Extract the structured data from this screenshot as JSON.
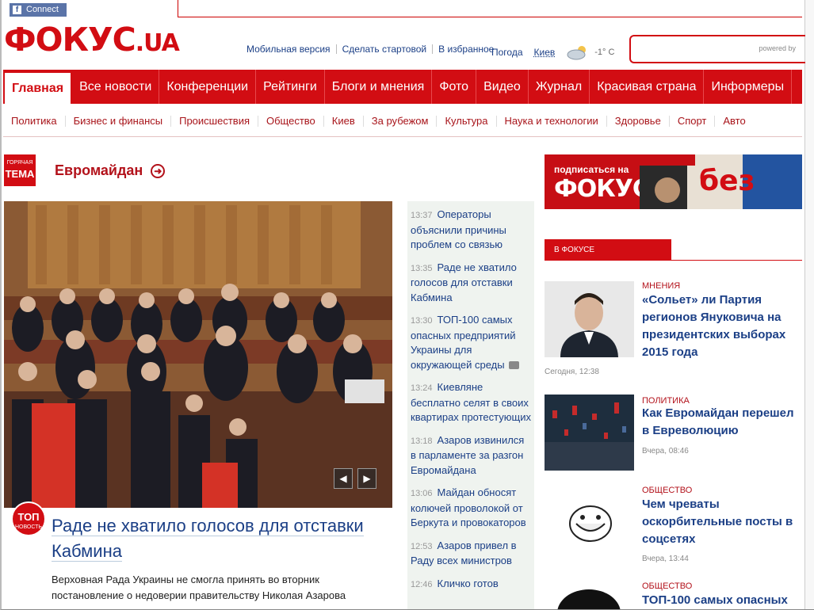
{
  "facebook": {
    "label": "Connect"
  },
  "logo": {
    "main": "ФОКУС",
    "suffix": ".UA"
  },
  "toplinks": [
    "Мобильная версия",
    "Сделать стартовой",
    "В избранное"
  ],
  "weather": {
    "label": "Погода",
    "city": "Киев",
    "temp": "-1° C",
    "icon": "cloud-sun-icon"
  },
  "search": {
    "powered": "powered by"
  },
  "mainnav": [
    "Главная",
    "Все новости",
    "Конференции",
    "Рейтинги",
    "Блоги и мнения",
    "Фото",
    "Видео",
    "Журнал",
    "Красивая страна",
    "Информеры"
  ],
  "subnav": [
    "Политика",
    "Бизнес и финансы",
    "Происшествия",
    "Общество",
    "Киев",
    "За рубежом",
    "Культура",
    "Наука и технологии",
    "Здоровье",
    "Спорт",
    "Авто"
  ],
  "hot": {
    "tag_small": "ГОРЯЧАЯ",
    "tag_big": "ТЕМА",
    "title": "Евромайдан"
  },
  "lead": {
    "badge_big": "ТОП",
    "badge_small": "НОВОСТЬ",
    "title": "Раде не хватило голосов для отставки Кабмина",
    "text": "Верховная Рада Украины не смогла принять во вторник постановление о недоверии правительству Николая Азарова"
  },
  "feed": [
    {
      "time": "13:37",
      "title": "Операторы объяснили причины проблем со связью"
    },
    {
      "time": "13:35",
      "title": "Раде не хватило голосов для отставки Кабмина"
    },
    {
      "time": "13:30",
      "title": "ТОП-100 самых опасных предприятий Украины для окружающей среды",
      "camera": true
    },
    {
      "time": "13:24",
      "title": "Киевляне бесплатно селят в своих квартирах протестующих"
    },
    {
      "time": "13:18",
      "title": "Азаров извинился в парламенте за разгон Евромайдана"
    },
    {
      "time": "13:06",
      "title": "Майдан обносят колючей проволокой от Беркута и провокаторов"
    },
    {
      "time": "12:53",
      "title": "Азаров привел в Раду всех министров"
    },
    {
      "time": "12:46",
      "title": "Кличко готов"
    }
  ],
  "banner": {
    "sub": "подписаться на",
    "big": "ФОКУС"
  },
  "infocus": {
    "label": "В ФОКУСЕ"
  },
  "cards": [
    {
      "cat": "МНЕНИЯ",
      "title": "«Сольет» ли Партия регионов Януковича на президентских выборах 2015 года",
      "date": "Сегодня, 12:38"
    },
    {
      "cat": "ПОЛИТИКА",
      "title": "Как Евромайдан перешел в Евреволюцию",
      "date": "Вчера, 08:46"
    },
    {
      "cat": "ОБЩЕСТВО",
      "title": "Чем чреваты оскорбительные посты в соцсетях",
      "date": "Вчера, 13:44"
    },
    {
      "cat": "ОБЩЕСТВО",
      "title": "ТОП-100 самых опасных"
    }
  ],
  "colors": {
    "brand_red": "#d20d13",
    "link_blue": "#1b3f86"
  }
}
